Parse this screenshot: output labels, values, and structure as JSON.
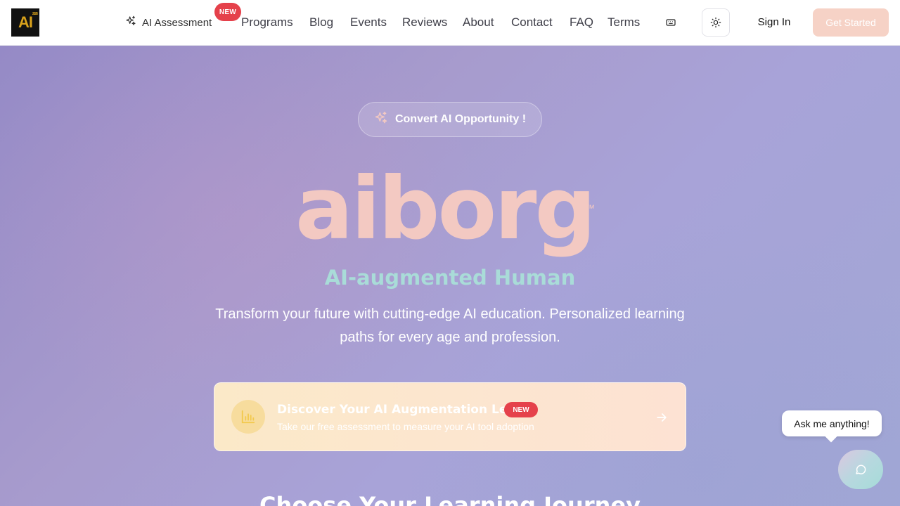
{
  "header": {
    "logo_text": "AI",
    "logo_small": "2026",
    "nav": {
      "ai_assessment": "AI Assessment",
      "new_badge": "NEW",
      "programs": "Programs",
      "blog": "Blog",
      "events": "Events",
      "reviews": "Reviews",
      "about": "About",
      "contact": "Contact",
      "faq": "FAQ",
      "terms": "Terms"
    },
    "sign_in": "Sign In",
    "get_started": "Get Started",
    "icons": {
      "sparkle": "sparkles-icon",
      "keyboard": "keyboard-icon",
      "theme": "sun-icon"
    }
  },
  "hero": {
    "pill_label": "Convert AI Opportunity !",
    "brand": "aiborg",
    "trademark": "™",
    "tagline": "AI-augmented Human",
    "description": "Transform your future with cutting-edge AI education. Personalized learning paths for every age and profession."
  },
  "assessment_card": {
    "title": "Discover Your AI Augmentation Level",
    "badge": "NEW",
    "subtitle": "Take our free assessment to measure your AI tool adoption",
    "icon": "bar-chart-icon",
    "arrow_icon": "arrow-right-icon"
  },
  "section": {
    "title": "Choose Your Learning Journey"
  },
  "chat": {
    "bubble": "Ask me anything!",
    "icon": "chat-icon"
  },
  "colors": {
    "brand": "#f3c9c2",
    "tagline": "#a9dcd8",
    "badge": "#e5414b",
    "cta": "#f6d2c6"
  }
}
